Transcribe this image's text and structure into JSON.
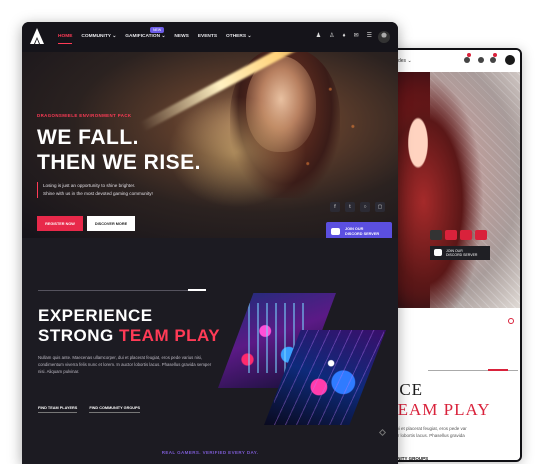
{
  "front": {
    "nav": {
      "menu": [
        {
          "label": "HOME"
        },
        {
          "label": "COMMUNITY ⌄"
        },
        {
          "label": "GAMIFICATION ⌄"
        },
        {
          "label": "NEWS"
        },
        {
          "label": "EVENTS"
        },
        {
          "label": "OTHERS ⌄"
        }
      ],
      "badge": "NEW"
    },
    "hero": {
      "eyebrow": "DRAGONSMIELE ENVIRONMENT PACK",
      "headline_line1": "WE FALL.",
      "headline_line2": "THEN WE RISE.",
      "desc_line1": "Losing is just an opportunity to shine brighter.",
      "desc_line2": "Shine with us in the most devoted gaming community!",
      "register_label": "REGISTER NOW",
      "discover_label": "DISCOVER MORE",
      "discord_line1": "JOIN OUR",
      "discord_line2": "DISCORD SERVER"
    },
    "section": {
      "title_line1": "EXPERIENCE",
      "title_line2_white": "STRONG ",
      "title_line2_red": "TEAM PLAY",
      "paragraph": "Nullam quis ante. Maecenas ullamcorper, dui et placerat feugiat, eros pede varius nisi, condimentum viverra felis nunc et lorem. In auctor lobortis lacus. Phasellus gravida semper nisi. Aliquam pulvinar.",
      "link1": "FIND TEAM PLAYERS",
      "link2": "FIND COMMUNITY GROUPS",
      "tagline": "REAL GAMERS. VERIFIED EVERY DAY."
    },
    "colors": {
      "accent": "#ff3b56",
      "discord": "#5b4fe0",
      "bg": "#1c1b22"
    }
  },
  "back": {
    "nav_word": "des ⌄",
    "discord_line1": "JOIN OUR",
    "discord_line2": "DISCORD SERVER",
    "title_line1": "IENCE",
    "title_line2_white": "G ",
    "title_line2_red": "TEAM PLAY",
    "paragraph": "ullamcorper, dui et placerat feugiat, eros pede var lorem. In auctor lobortis lacus. Phasellus gravida",
    "link": "FIND COMMUNITY GROUPS"
  }
}
